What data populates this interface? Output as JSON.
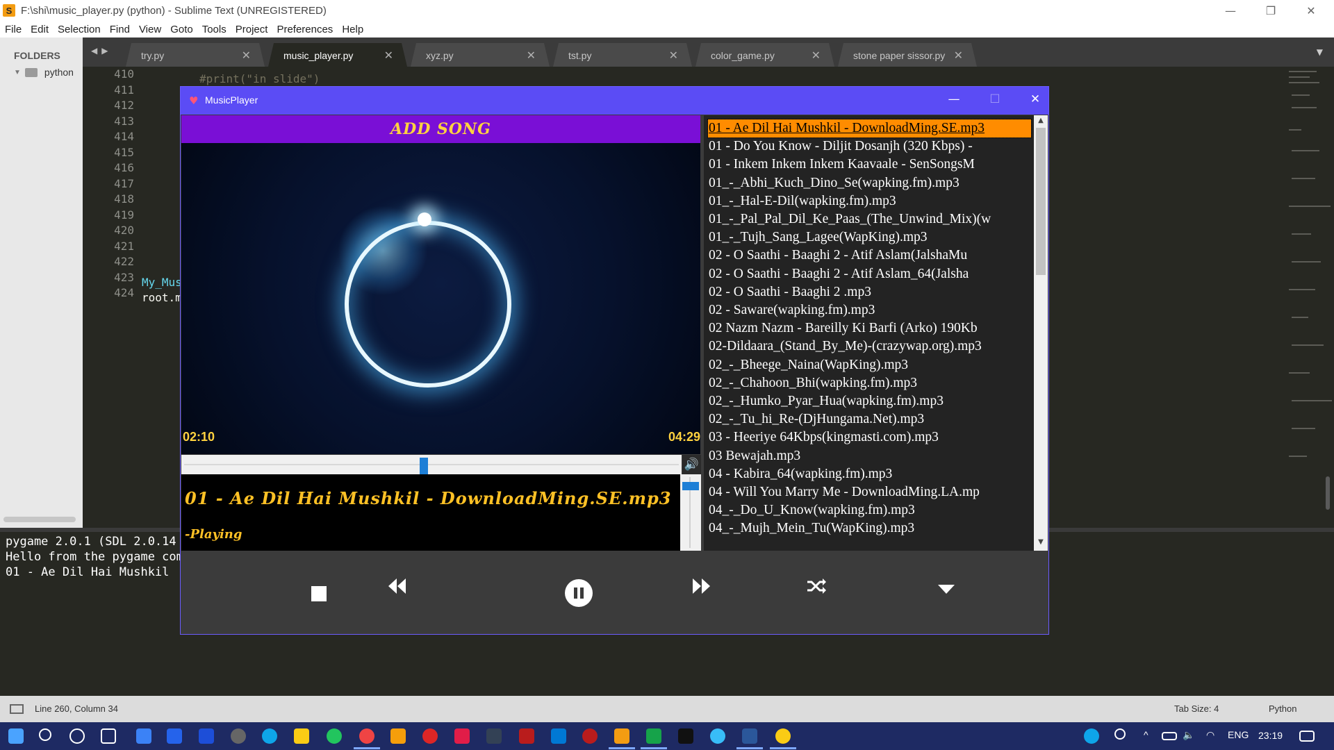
{
  "window": {
    "title": "F:\\shi\\music_player.py (python) - Sublime Text (UNREGISTERED)",
    "controls": {
      "minimize": "—",
      "restore": "❐",
      "close": "✕"
    }
  },
  "menu": [
    "File",
    "Edit",
    "Selection",
    "Find",
    "View",
    "Goto",
    "Tools",
    "Project",
    "Preferences",
    "Help"
  ],
  "sidebar": {
    "header": "FOLDERS",
    "folder": "python"
  },
  "tabs": [
    {
      "label": "try.py",
      "active": false
    },
    {
      "label": "music_player.py",
      "active": true
    },
    {
      "label": "xyz.py",
      "active": false
    },
    {
      "label": "tst.py",
      "active": false
    },
    {
      "label": "color_game.py",
      "active": false
    },
    {
      "label": "stone paper sissor.py",
      "active": false
    }
  ],
  "editor": {
    "line_numbers": [
      "410",
      "411",
      "412",
      "413",
      "414",
      "415",
      "416",
      "417",
      "418",
      "419",
      "420",
      "421",
      "422",
      "423",
      "424"
    ],
    "code": {
      "line410": "#print(\"in slide\")",
      "line423": "My_Mus",
      "line424": "root.m"
    }
  },
  "console": {
    "lines": [
      "pygame 2.0.1 (SDL 2.0.14",
      "Hello from the pygame com",
      "01 - Ae Dil Hai Mushkil"
    ]
  },
  "statusbar": {
    "position": "Line 260, Column 34",
    "tab_size": "Tab Size: 4",
    "syntax": "Python"
  },
  "taskbar": {
    "language": "ENG",
    "time": "23:19"
  },
  "player": {
    "title": "MusicPlayer",
    "add_song": "ADD SONG",
    "elapsed": "02:10",
    "total": "04:29",
    "progress_fraction": 0.485,
    "volume_fraction": 0.93,
    "now_playing": "01 - Ae Dil Hai Mushkil - DownloadMing.SE.mp3",
    "status": "-Playing",
    "icons": {
      "stop": "stop-icon",
      "previous": "rewind-icon",
      "pause": "pause-icon",
      "next": "fast-forward-icon",
      "shuffle": "shuffle-icon",
      "more": "caret-down-icon",
      "volume": "speaker-icon"
    },
    "playlist": [
      "01 - Ae Dil Hai Mushkil - DownloadMing.SE.mp3",
      "01 - Do You Know - Diljit Dosanjh (320 Kbps) - ",
      "01 - Inkem Inkem Inkem Kaavaale - SenSongsM",
      "01_-_Abhi_Kuch_Dino_Se(wapking.fm).mp3",
      "01_-_Hal-E-Dil(wapking.fm).mp3",
      "01_-_Pal_Pal_Dil_Ke_Paas_(The_Unwind_Mix)(w",
      "01_-_Tujh_Sang_Lagee(WapKing).mp3",
      "02 - O Saathi - Baaghi 2 - Atif Aslam(JalshaMu",
      "02 - O Saathi - Baaghi 2 - Atif Aslam_64(Jalsha",
      "02 - O Saathi - Baaghi 2 .mp3",
      "02 - Saware(wapking.fm).mp3",
      "02 Nazm Nazm - Bareilly Ki Barfi (Arko) 190Kb",
      "02-Dildaara_(Stand_By_Me)-(crazywap.org).mp3",
      "02_-_Bheege_Naina(WapKing).mp3",
      "02_-_Chahoon_Bhi(wapking.fm).mp3",
      "02_-_Humko_Pyar_Hua(wapking.fm).mp3",
      "02_-_Tu_hi_Re-(DjHungama.Net).mp3",
      "03 - Heeriye 64Kbps(kingmasti.com).mp3",
      "03 Bewajah.mp3",
      "04 - Kabira_64(wapking.fm).mp3",
      "04 - Will You Marry Me - DownloadMing.LA.mp",
      "04_-_Do_U_Know(wapking.fm).mp3",
      "04_-_Mujh_Mein_Tu(WapKing).mp3"
    ],
    "selected_index": 0
  }
}
